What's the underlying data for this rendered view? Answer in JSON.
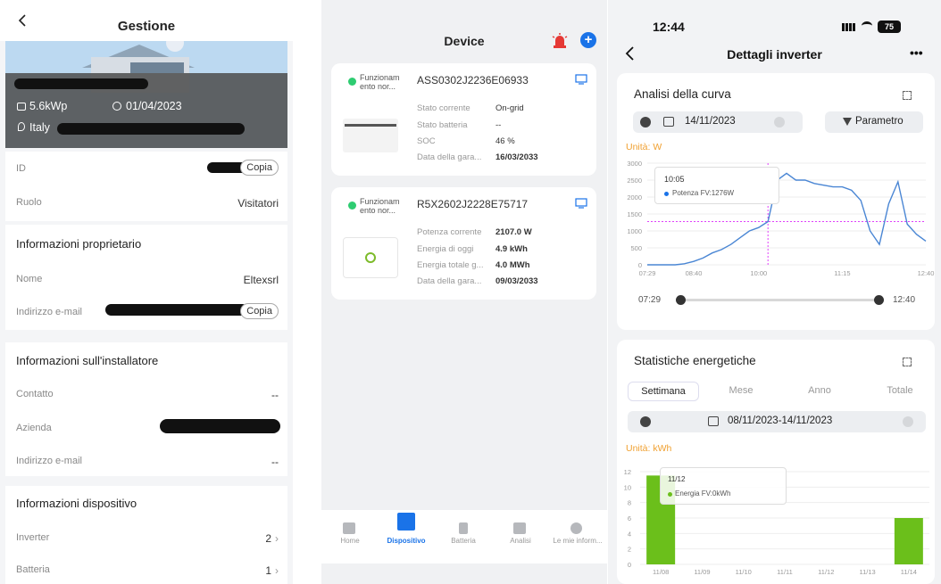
{
  "panel1": {
    "title": "Gestione",
    "hero": {
      "power": "5.6kWp",
      "date": "01/04/2023",
      "location": "Italy"
    },
    "id_label": "ID",
    "copy_label": "Copia",
    "role_label": "Ruolo",
    "role_value": "Visitatori",
    "owner_section": "Informazioni proprietario",
    "name_label": "Nome",
    "name_value": "Eltexsrl",
    "email_label": "Indirizzo e-mail",
    "installer_section": "Informazioni sull'installatore",
    "contact_label": "Contatto",
    "contact_value": "--",
    "company_label": "Azienda",
    "installer_email_label": "Indirizzo e-mail",
    "installer_email_value": "--",
    "device_section": "Informazioni dispositivo",
    "inverter_label": "Inverter",
    "inverter_count": "2",
    "battery_label": "Batteria",
    "battery_count": "1"
  },
  "panel2": {
    "title": "Device",
    "devices": [
      {
        "status": "Funzionam ento nor...",
        "serial": "ASS0302J2236E06933",
        "fields": [
          {
            "k": "Stato corrente",
            "v": "On-grid"
          },
          {
            "k": "Stato batteria",
            "v": "--"
          },
          {
            "k": "SOC",
            "v": "46 %"
          },
          {
            "k": "Data della gara...",
            "v": "16/03/2033"
          }
        ]
      },
      {
        "status": "Funzionam ento nor...",
        "serial": "R5X2602J2228E75717",
        "fields": [
          {
            "k": "Potenza corrente",
            "v": "2107.0 W"
          },
          {
            "k": "Energia di oggi",
            "v": "4.9 kWh"
          },
          {
            "k": "Energia totale g...",
            "v": "4.0 MWh"
          },
          {
            "k": "Data della gara...",
            "v": "09/03/2033"
          }
        ]
      }
    ],
    "tabs": [
      "Home",
      "Dispositivo",
      "Batteria",
      "Analisi",
      "Le mie inform..."
    ]
  },
  "panel3": {
    "time": "12:44",
    "battery": "75",
    "title": "Dettagli inverter",
    "more": "•••",
    "curve": {
      "title": "Analisi della curva",
      "date": "14/11/2023",
      "param_label": "Parametro",
      "unit": "Unità: W",
      "tooltip_time": "10:05",
      "tooltip_text": "Potenza FV:1276W",
      "range_start": "07:29",
      "range_end": "12:40"
    },
    "stats": {
      "title": "Statistiche energetiche",
      "segments": [
        "Settimana",
        "Mese",
        "Anno",
        "Totale"
      ],
      "date_range": "08/11/2023-14/11/2023",
      "unit": "Unità: kWh",
      "tooltip_date": "11/12",
      "tooltip_text": "Energia FV:0kWh"
    }
  },
  "chart_data": [
    {
      "type": "line",
      "x": [
        "07:29",
        "07:45",
        "08:00",
        "08:15",
        "08:30",
        "08:40",
        "08:55",
        "09:05",
        "09:20",
        "09:30",
        "09:40",
        "09:50",
        "10:00",
        "10:05",
        "10:10",
        "10:15",
        "10:25",
        "10:35",
        "10:45",
        "10:55",
        "11:05",
        "11:15",
        "11:25",
        "11:35",
        "11:45",
        "11:55",
        "12:05",
        "12:15",
        "12:20",
        "12:30",
        "12:40"
      ],
      "series": [
        {
          "values": [
            0,
            0,
            0,
            0,
            30,
            100,
            200,
            350,
            450,
            600,
            800,
            1000,
            1100,
            1276,
            2500,
            2700,
            2500,
            2500,
            2400,
            2350,
            2300,
            2300,
            2200,
            1900,
            1000,
            600,
            1800,
            2450,
            1200,
            900,
            700
          ]
        }
      ],
      "xticks": [
        "07:29",
        "08:40",
        "10:00",
        "11:15",
        "12:40"
      ],
      "yticks": [
        0,
        500,
        1000,
        1500,
        2000,
        2500,
        3000
      ],
      "ylim": [
        0,
        3000
      ]
    },
    {
      "type": "bar",
      "categories": [
        "11/08",
        "11/09",
        "11/10",
        "11/11",
        "11/12",
        "11/13",
        "11/14"
      ],
      "series": [
        {
          "values": [
            11.5,
            0,
            0,
            0,
            0,
            0,
            6
          ]
        }
      ],
      "yticks": [
        0,
        2,
        4,
        6,
        8,
        10,
        12
      ],
      "ylim": [
        0,
        12
      ]
    }
  ]
}
